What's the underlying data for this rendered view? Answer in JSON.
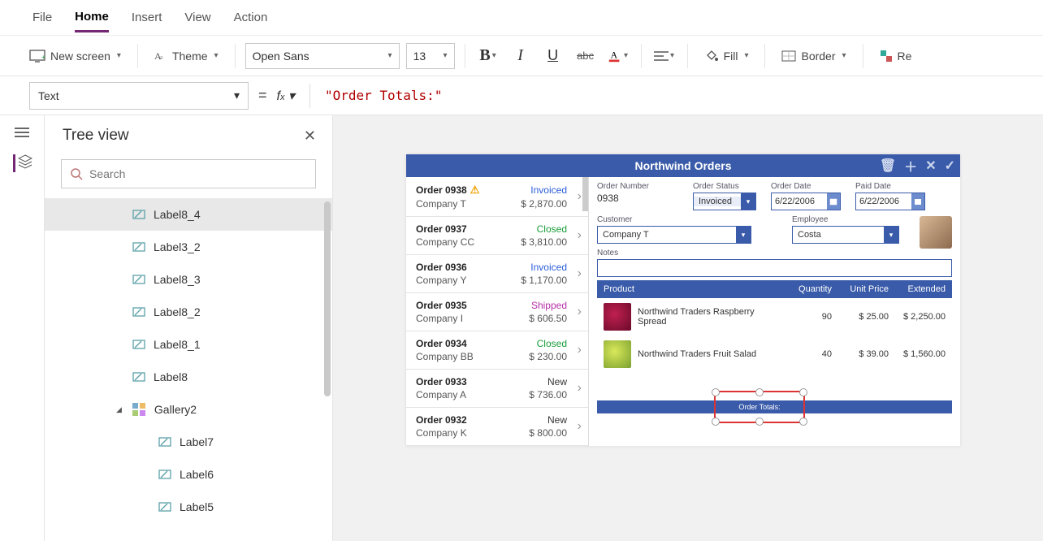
{
  "menu": {
    "file": "File",
    "home": "Home",
    "insert": "Insert",
    "view": "View",
    "action": "Action"
  },
  "ribbon": {
    "newscreen": "New screen",
    "theme": "Theme",
    "font": "Open Sans",
    "size": "13",
    "fill": "Fill",
    "border": "Border",
    "reorder": "Re"
  },
  "formulabar": {
    "property": "Text",
    "formula": "\"Order Totals:\""
  },
  "tree": {
    "title": "Tree view",
    "search_placeholder": "Search",
    "items": [
      "Label8_4",
      "Label3_2",
      "Label8_3",
      "Label8_2",
      "Label8_1",
      "Label8"
    ],
    "gallery": "Gallery2",
    "children": [
      "Label7",
      "Label6",
      "Label5"
    ]
  },
  "app": {
    "title": "Northwind Orders",
    "orders": [
      {
        "name": "Order 0938",
        "company": "Company T",
        "amount": "$ 2,870.00",
        "status": "Invoiced",
        "warn": true
      },
      {
        "name": "Order 0937",
        "company": "Company CC",
        "amount": "$ 3,810.00",
        "status": "Closed"
      },
      {
        "name": "Order 0936",
        "company": "Company Y",
        "amount": "$ 1,170.00",
        "status": "Invoiced"
      },
      {
        "name": "Order 0935",
        "company": "Company I",
        "amount": "$ 606.50",
        "status": "Shipped"
      },
      {
        "name": "Order 0934",
        "company": "Company BB",
        "amount": "$ 230.00",
        "status": "Closed"
      },
      {
        "name": "Order 0933",
        "company": "Company A",
        "amount": "$ 736.00",
        "status": "New"
      },
      {
        "name": "Order 0932",
        "company": "Company K",
        "amount": "$ 800.00",
        "status": "New"
      }
    ],
    "detail": {
      "labels": {
        "ordernum": "Order Number",
        "orderstatus": "Order Status",
        "orderdate": "Order Date",
        "paiddate": "Paid Date",
        "customer": "Customer",
        "employee": "Employee",
        "notes": "Notes"
      },
      "ordernum": "0938",
      "status": "Invoiced",
      "orderdate": "6/22/2006",
      "paiddate": "6/22/2006",
      "customer": "Company T",
      "employee": "Costa"
    },
    "prodhead": {
      "product": "Product",
      "qty": "Quantity",
      "unit": "Unit Price",
      "ext": "Extended"
    },
    "products": [
      {
        "name": "Northwind Traders Raspberry Spread",
        "qty": "90",
        "unit": "$ 25.00",
        "ext": "$ 2,250.00",
        "thumb": "berry"
      },
      {
        "name": "Northwind Traders Fruit Salad",
        "qty": "40",
        "unit": "$ 39.00",
        "ext": "$ 1,560.00",
        "thumb": "salad"
      }
    ],
    "sel_label": "Order Totals:"
  }
}
